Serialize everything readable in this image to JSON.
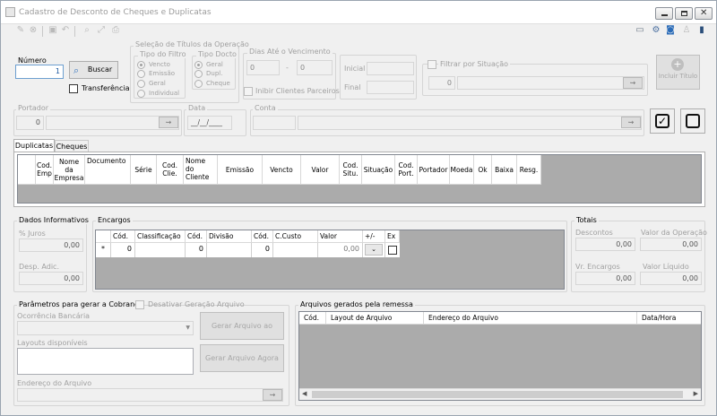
{
  "window": {
    "title": "Cadastro de Desconto de Cheques e Duplicatas"
  },
  "top": {
    "numero_label": "Número",
    "numero_value": "1",
    "buscar_label": "Buscar",
    "transferencia_label": "Transferência"
  },
  "selecao": {
    "title": "Seleção de Títulos da Operação",
    "filtro_title": "Tipo do Filtro",
    "filtro_options": [
      "Vencto",
      "Emissão",
      "Geral",
      "Individual"
    ],
    "docto_title": "Tipo Docto",
    "docto_options": [
      "Geral",
      "Dupl.",
      "Cheque"
    ]
  },
  "dias": {
    "title": "Dias Até o Vencimento",
    "from": "0",
    "dash": "-",
    "to": "0",
    "inibir_label": "Inibir Clientes Parceiros"
  },
  "datas": {
    "inicial_label": "Inicial",
    "final_label": "Final"
  },
  "situacao": {
    "label": "Filtrar por Situação",
    "value": "0"
  },
  "incluir": {
    "label": "Incluir Título"
  },
  "portador": {
    "label": "Portador",
    "value": "0"
  },
  "data": {
    "label": "Data",
    "value": "__/__/____"
  },
  "conta": {
    "label": "Conta"
  },
  "tabs": [
    "Duplicatas",
    "Cheques"
  ],
  "dup_columns": [
    "Cod. Emp",
    "Nome da Empresa",
    "Documento",
    "Série",
    "Cod. Clie.",
    "Nome do Cliente",
    "Emissão",
    "Vencto",
    "Valor",
    "Cod. Situ.",
    "Situação",
    "Cod. Port.",
    "Portador",
    "Moeda",
    "Ok",
    "Baixa",
    "Resg."
  ],
  "dados": {
    "title": "Dados Informativos",
    "juros_label": "% Juros",
    "juros_value": "0,00",
    "desp_label": "Desp. Adic.",
    "desp_value": "0,00"
  },
  "encargos": {
    "title": "Encargos",
    "columns": [
      "Cód.",
      "Classificação",
      "Cód.",
      "Divisão",
      "Cód.",
      "C.Custo",
      "Valor",
      "+/-",
      "Ex"
    ],
    "row": {
      "marker": "*",
      "c1": "0",
      "c2": "0",
      "c3": "0",
      "valor": "0,00"
    }
  },
  "totais": {
    "title": "Totais",
    "descontos_label": "Descontos",
    "descontos_value": "0,00",
    "valop_label": "Valor da Operação",
    "valop_value": "0,00",
    "vrenc_label": "Vr. Encargos",
    "vrenc_value": "0,00",
    "valliq_label": "Valor Líquido",
    "valliq_value": "0,00"
  },
  "params": {
    "title": "Parâmetros para gerar a Cobrança",
    "desativar_label": "Desativar Geração Arquivo",
    "ocorrencia_label": "Ocorrência Bancária",
    "layouts_label": "Layouts disponíveis",
    "endereco_label": "Endereço do Arquivo",
    "gerar_gravar_label": "Gerar Arquivo ao Gravar",
    "gerar_agora_label": "Gerar Arquivo Agora"
  },
  "arquivos": {
    "title": "Arquivos gerados pela remessa",
    "columns": [
      "Cód.",
      "Layout de Arquivo",
      "Endereço do Arquivo",
      "Data/Hora"
    ]
  }
}
